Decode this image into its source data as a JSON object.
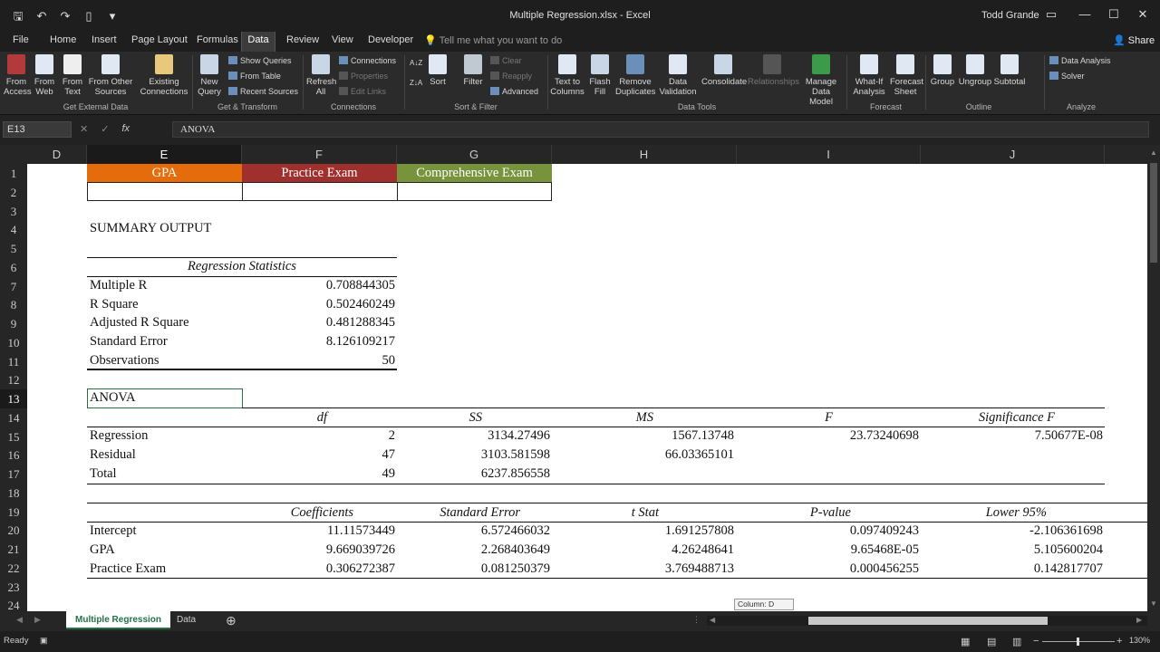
{
  "window": {
    "title": "Multiple Regression.xlsx - Excel",
    "user": "Todd Grande",
    "qat": {
      "save_icon": "save-icon",
      "undo_icon": "undo-icon",
      "redo_icon": "redo-icon",
      "new_icon": "new-file-icon",
      "more_icon": "customize-qat-icon"
    },
    "controls": {
      "ribbon_options": "▭",
      "minimize": "—",
      "maximize": "☐",
      "close": "✕"
    }
  },
  "menu": {
    "tabs": [
      "File",
      "Home",
      "Insert",
      "Page Layout",
      "Formulas",
      "Data",
      "Review",
      "View",
      "Developer"
    ],
    "active": "Data",
    "tell_me": "Tell me what you want to do",
    "share": "Share"
  },
  "ribbon": {
    "get_external": {
      "label": "Get External Data",
      "buttons": [
        "From\nAccess",
        "From\nWeb",
        "From\nText",
        "From Other\nSources",
        "Existing\nConnections"
      ]
    },
    "get_transform": {
      "label": "Get & Transform",
      "new_query": "New\nQuery",
      "items": [
        "Show Queries",
        "From Table",
        "Recent Sources"
      ]
    },
    "connections": {
      "label": "Connections",
      "refresh": "Refresh\nAll",
      "items": [
        "Connections",
        "Properties",
        "Edit Links"
      ]
    },
    "sort_filter": {
      "label": "Sort & Filter",
      "sort": "Sort",
      "filter": "Filter",
      "items": [
        "Clear",
        "Reapply",
        "Advanced"
      ]
    },
    "data_tools": {
      "label": "Data Tools",
      "buttons": [
        "Text to\nColumns",
        "Flash\nFill",
        "Remove\nDuplicates",
        "Data\nValidation",
        "Consolidate",
        "Relationships",
        "Manage\nData Model"
      ]
    },
    "forecast": {
      "label": "Forecast",
      "buttons": [
        "What-If\nAnalysis",
        "Forecast\nSheet"
      ]
    },
    "outline": {
      "label": "Outline",
      "buttons": [
        "Group",
        "Ungroup",
        "Subtotal"
      ]
    },
    "analyze": {
      "label": "Analyze",
      "items": [
        "Data Analysis",
        "Solver"
      ]
    }
  },
  "formula_bar": {
    "name_box": "E13",
    "content": "ANOVA"
  },
  "columns": [
    "D",
    "E",
    "F",
    "G",
    "H",
    "I",
    "J"
  ],
  "rows": [
    "1",
    "2",
    "3",
    "4",
    "5",
    "6",
    "7",
    "8",
    "9",
    "10",
    "11",
    "12",
    "13",
    "14",
    "15",
    "16",
    "17",
    "18",
    "19",
    "20",
    "21",
    "22",
    "23",
    "24"
  ],
  "sheet": {
    "headers": {
      "gpa": "GPA",
      "practice": "Practice Exam",
      "comprehensive": "Comprehensive Exam"
    },
    "colors": {
      "gpa": "#E46C0A",
      "practice": "#A0302E",
      "comprehensive": "#77933C"
    },
    "summary_title": "SUMMARY OUTPUT",
    "regstats": {
      "title": "Regression Statistics",
      "rows": [
        {
          "label": "Multiple R",
          "value": "0.708844305"
        },
        {
          "label": "R Square",
          "value": "0.502460249"
        },
        {
          "label": "Adjusted R Square",
          "value": "0.481288345"
        },
        {
          "label": "Standard Error",
          "value": "8.126109217"
        },
        {
          "label": "Observations",
          "value": "50"
        }
      ]
    },
    "anova": {
      "title": "ANOVA",
      "headers": [
        "df",
        "SS",
        "MS",
        "F",
        "Significance F"
      ],
      "rows": [
        {
          "label": "Regression",
          "df": "2",
          "ss": "3134.27496",
          "ms": "1567.13748",
          "f": "23.73240698",
          "sig": "7.50677E-08"
        },
        {
          "label": "Residual",
          "df": "47",
          "ss": "3103.581598",
          "ms": "66.03365101"
        },
        {
          "label": "Total",
          "df": "49",
          "ss": "6237.856558"
        }
      ]
    },
    "coef": {
      "headers": [
        "Coefficients",
        "Standard Error",
        "t Stat",
        "P-value",
        "Lower 95%"
      ],
      "rows": [
        {
          "label": "Intercept",
          "coef": "11.11573449",
          "se": "6.572466032",
          "t": "1.691257808",
          "p": "0.097409243",
          "lower": "-2.106361698"
        },
        {
          "label": "GPA",
          "coef": "9.669039726",
          "se": "2.268403649",
          "t": "4.26248641",
          "p": "9.65468E-05",
          "lower": "5.105600204"
        },
        {
          "label": "Practice Exam",
          "coef": "0.306272387",
          "se": "0.081250379",
          "t": "3.769488713",
          "p": "0.000456255",
          "lower": "0.142817707"
        }
      ]
    }
  },
  "sheet_tabs": [
    "Multiple Regression",
    "Data"
  ],
  "column_tip": "Column: D",
  "status": {
    "ready": "Ready",
    "zoom": "130%"
  }
}
